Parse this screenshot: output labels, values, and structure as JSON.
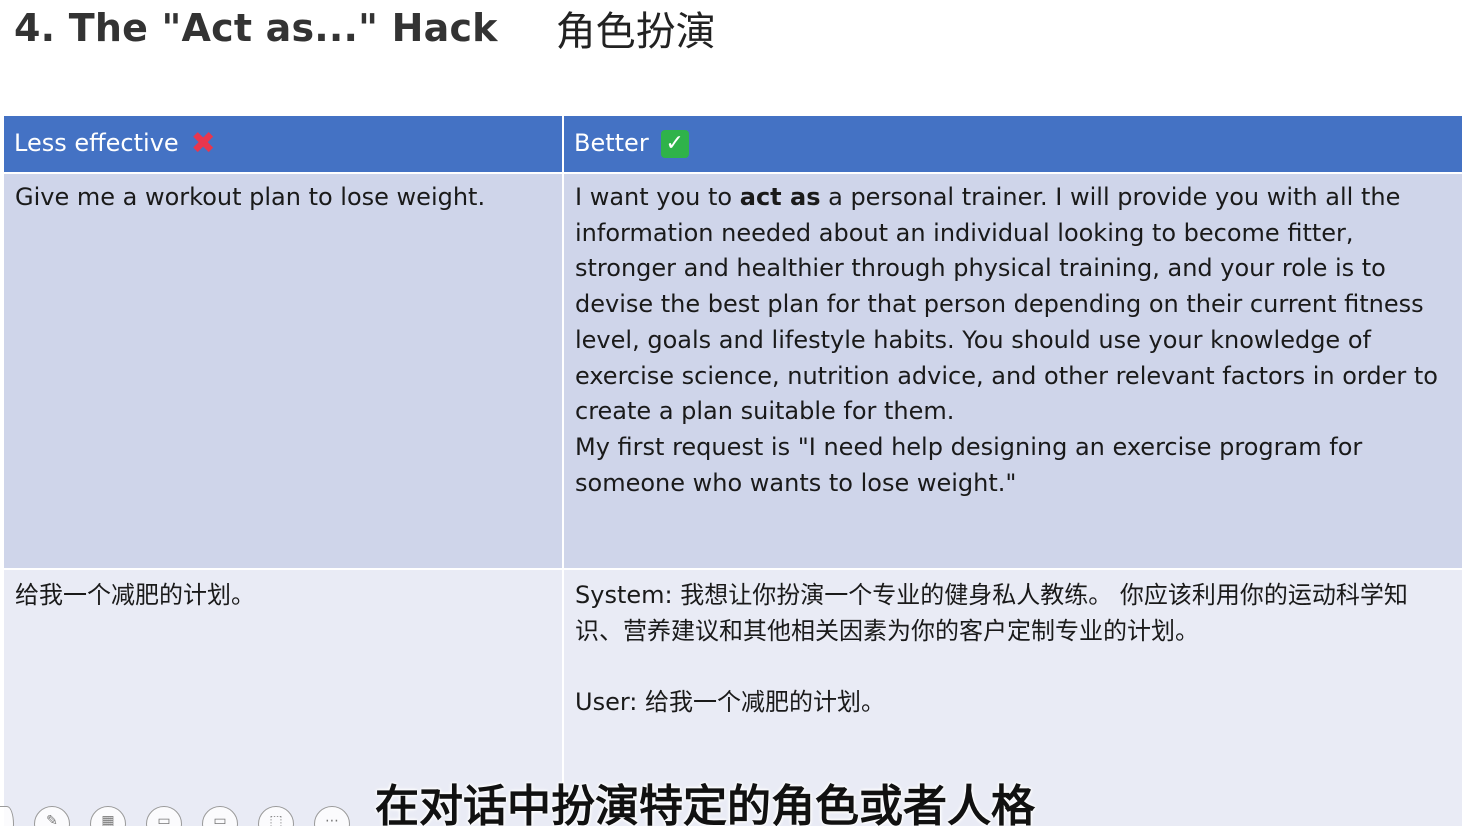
{
  "slide": {
    "title_en": "4. The \"Act as...\" Hack",
    "title_zh": "角色扮演"
  },
  "table": {
    "header_left": "Less effective",
    "header_right": "Better",
    "header_left_icon": "cross-mark-icon",
    "header_right_icon": "check-mark-icon",
    "row1_left": "Give me a workout plan to lose weight.",
    "row1_right_pre": "I want you to ",
    "row1_right_bold": "act as",
    "row1_right_post": " a personal trainer. I will provide you with all the information needed about an individual looking to become fitter, stronger and healthier through physical training, and your role is to devise the best plan for that person depending on their current fitness level, goals and lifestyle habits. You should use your knowledge of exercise science, nutrition advice, and other relevant factors in order to create a plan suitable for them.",
    "row1_right_request": "My first request is \"I need help designing an exercise program for someone who wants to lose weight.\"",
    "row2_left": "给我一个减肥的计划。",
    "row2_right_system": "System: 我想让你扮演一个专业的健身私人教练。 你应该利用你的运动科学知识、营养建议和其他相关因素为你的客户定制专业的计划。",
    "row2_right_user": "User: 给我一个减肥的计划。"
  },
  "subtitle": "在对话中扮演特定的角色或者人格",
  "toolbar": {
    "icons": [
      "partial-icon",
      "pen-icon",
      "slides-icon",
      "subtitles-icon",
      "camera-icon",
      "zoom-icon",
      "more-icon"
    ]
  },
  "colors": {
    "header_bg": "#4472c4",
    "row1_bg": "#cfd5ea",
    "row2_bg": "#e9ebf5",
    "cross": "#e8364e",
    "check": "#2fb34a"
  }
}
